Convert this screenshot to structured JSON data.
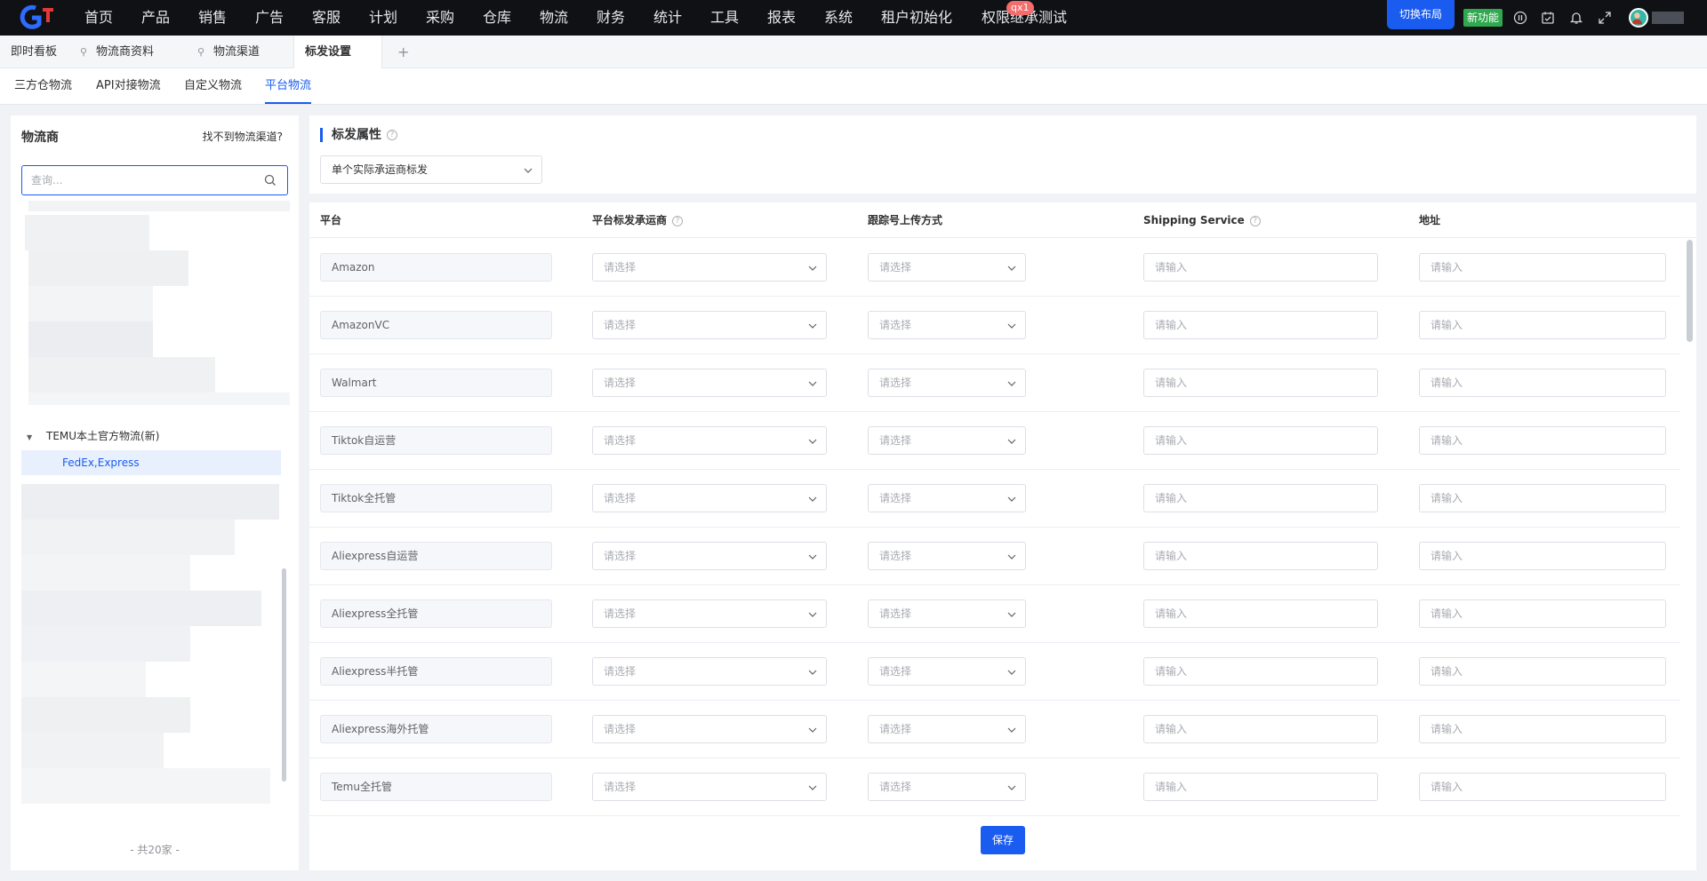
{
  "topnav": {
    "menu": [
      "首页",
      "产品",
      "销售",
      "广告",
      "客服",
      "计划",
      "采购",
      "仓库",
      "物流",
      "财务",
      "统计",
      "工具",
      "报表",
      "系统",
      "租户初始化",
      "权限继承测试"
    ],
    "badge": "qx1",
    "switch_layout": "切换布局",
    "new_feature": "新功能",
    "icons": [
      "pause-circle-icon",
      "calendar-check-icon",
      "bell-icon",
      "fullscreen-icon"
    ],
    "colors": {
      "bar": "#0f1115",
      "accent": "#1a5cf0",
      "new_feature": "#2fa84f"
    }
  },
  "tabs": [
    {
      "label": "即时看板",
      "pinned": false
    },
    {
      "label": "物流商资料",
      "pinned": true
    },
    {
      "label": "物流渠道",
      "pinned": true
    },
    {
      "label": "标发设置",
      "pinned": false,
      "active": true
    }
  ],
  "tab_add": "+",
  "subtabs": [
    {
      "label": "三方仓物流"
    },
    {
      "label": "API对接物流"
    },
    {
      "label": "自定义物流"
    },
    {
      "label": "平台物流",
      "active": true
    }
  ],
  "left": {
    "title": "物流商",
    "link": "找不到物流渠道?",
    "search_placeholder": "查询...",
    "tree_parent": "TEMU本土官方物流(新)",
    "tree_child": "FedEx,Express",
    "footer": "- 共20家 -"
  },
  "right": {
    "section_title": "标发属性",
    "mode_select": "单个实际承运商标发",
    "headers": [
      "平台",
      "平台标发承运商",
      "跟踪号上传方式",
      "Shipping Service",
      "地址"
    ],
    "select_placeholder": "请选择",
    "input_placeholder": "请输入",
    "rows": [
      "Amazon",
      "AmazonVC",
      "Walmart",
      "Tiktok自运营",
      "Tiktok全托管",
      "Aliexpress自运营",
      "Aliexpress全托管",
      "Aliexpress半托管",
      "Aliexpress海外托管",
      "Temu全托管"
    ],
    "save": "保存"
  }
}
